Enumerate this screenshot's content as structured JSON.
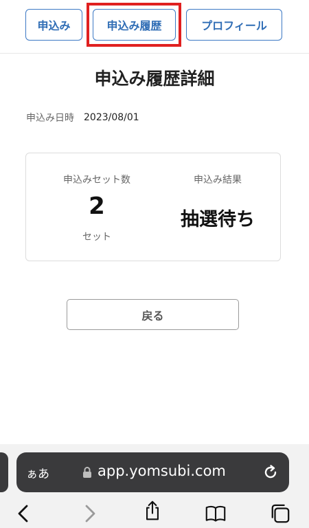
{
  "nav": {
    "apply_label": "申込み",
    "history_label": "申込み履歴",
    "profile_label": "プロフィール"
  },
  "title": "申込み履歴詳細",
  "date": {
    "label": "申込み日時",
    "value": "2023/08/01"
  },
  "card": {
    "set_count_label": "申込みセット数",
    "set_count": "2",
    "set_unit": "セット",
    "result_label": "申込み結果",
    "result_value": "抽選待ち"
  },
  "back_label": "戻る",
  "browser": {
    "aa_label": "ぁあ",
    "url": "app.yomsubi.com"
  },
  "colors": {
    "nav_accent": "#2f6db5",
    "highlight": "#e02020",
    "address_bar": "#3a3a3c"
  },
  "icons": {
    "lock": "lock-icon",
    "reload": "reload-icon",
    "back": "chevron-left-icon",
    "forward": "chevron-right-icon",
    "share": "share-icon",
    "bookmarks": "book-icon",
    "tabs": "tabs-icon"
  }
}
